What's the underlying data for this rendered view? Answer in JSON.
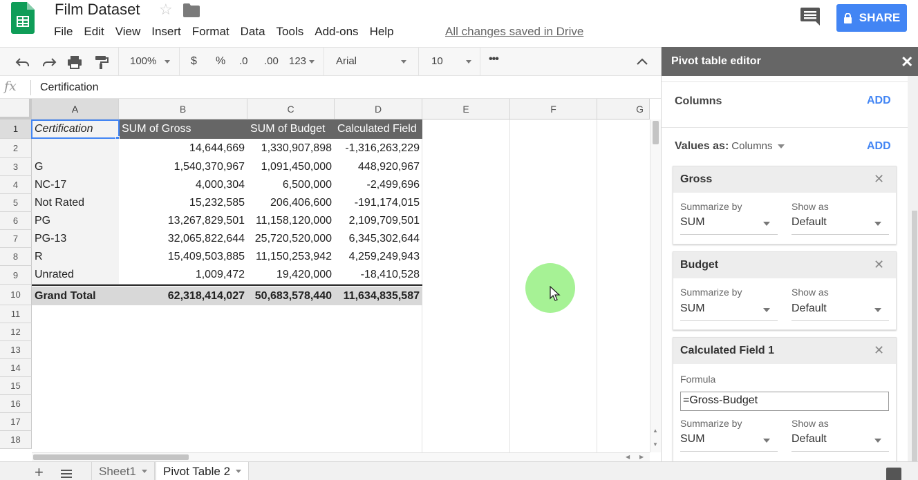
{
  "header": {
    "title": "Film Dataset",
    "menu": [
      "File",
      "Edit",
      "View",
      "Insert",
      "Format",
      "Data",
      "Tools",
      "Add-ons",
      "Help"
    ],
    "saved_status": "All changes saved in Drive",
    "share_label": "SHARE",
    "brand_color": "#0f9d58",
    "share_color": "#4285f4"
  },
  "toolbar": {
    "zoom": "100%",
    "currency": "$",
    "percent": "%",
    "dec_decrease": ".0",
    "dec_increase": ".00",
    "more_formats": "123",
    "font": "Arial",
    "font_size": "10",
    "more": "•••"
  },
  "formula_bar": {
    "fx": "fx",
    "value": "Certification"
  },
  "grid": {
    "columns": [
      "A",
      "B",
      "C",
      "D",
      "E",
      "F",
      "G"
    ],
    "rows": [
      "1",
      "2",
      "3",
      "4",
      "5",
      "6",
      "7",
      "8",
      "9",
      "10",
      "11",
      "12",
      "13",
      "14",
      "15",
      "16",
      "17",
      "18"
    ],
    "pivot_header": [
      "Certification",
      "SUM of Gross",
      "SUM of Budget",
      "Calculated Field"
    ],
    "pivot_rows": [
      [
        "",
        "14,644,669",
        "1,330,907,898",
        "-1,316,263,229"
      ],
      [
        "G",
        "1,540,370,967",
        "1,091,450,000",
        "448,920,967"
      ],
      [
        "NC-17",
        "4,000,304",
        "6,500,000",
        "-2,499,696"
      ],
      [
        "Not Rated",
        "15,232,585",
        "206,406,600",
        "-191,174,015"
      ],
      [
        "PG",
        "13,267,829,501",
        "11,158,120,000",
        "2,109,709,501"
      ],
      [
        "PG-13",
        "32,065,822,644",
        "25,720,520,000",
        "6,345,302,644"
      ],
      [
        "R",
        "15,409,503,885",
        "11,150,253,942",
        "4,259,249,943"
      ],
      [
        "Unrated",
        "1,009,472",
        "19,420,000",
        "-18,410,528"
      ]
    ],
    "grand_total": [
      "Grand Total",
      "62,318,414,027",
      "50,683,578,440",
      "11,634,835,587"
    ]
  },
  "sheets": {
    "tabs": [
      "Sheet1",
      "Pivot Table 2"
    ],
    "active": "Pivot Table 2"
  },
  "pivot_editor": {
    "title": "Pivot table editor",
    "columns_label": "Columns",
    "add_label": "ADD",
    "values_as_label": "Values as:",
    "values_as_value": "Columns",
    "cards": [
      {
        "name": "Gross",
        "summarize_label": "Summarize by",
        "summarize_value": "SUM",
        "show_as_label": "Show as",
        "show_as_value": "Default"
      },
      {
        "name": "Budget",
        "summarize_label": "Summarize by",
        "summarize_value": "SUM",
        "show_as_label": "Show as",
        "show_as_value": "Default"
      },
      {
        "name": "Calculated Field 1",
        "formula_label": "Formula",
        "formula_value": "=Gross-Budget",
        "summarize_label": "Summarize by",
        "summarize_value": "SUM",
        "show_as_label": "Show as",
        "show_as_value": "Default"
      }
    ]
  }
}
